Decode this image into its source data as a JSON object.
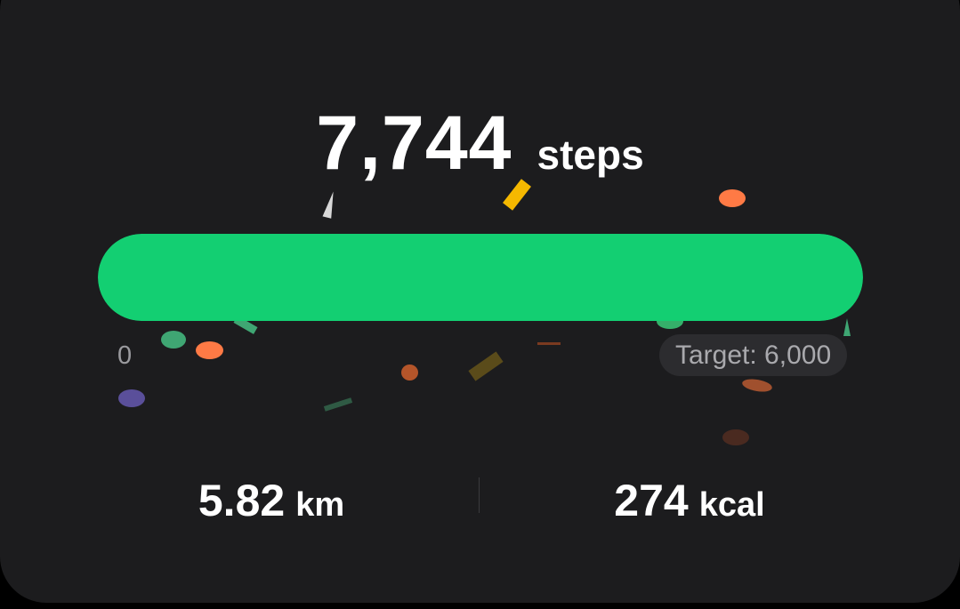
{
  "steps": {
    "value": "7,744",
    "unit": "steps"
  },
  "progress": {
    "current": 7744,
    "target": 6000,
    "fraction": 1.0,
    "min_label": "0",
    "target_label": "Target: 6,000",
    "color": "#13cf72"
  },
  "stats": {
    "distance": {
      "value": "5.82",
      "unit": "km"
    },
    "calories": {
      "value": "274",
      "unit": "kcal"
    }
  },
  "colors": {
    "card_background": "#1c1c1e",
    "page_background": "#000000",
    "accent_green": "#13cf72",
    "confetti": [
      "#f5b800",
      "#ff7a45",
      "#3fa673",
      "#5a4f9a",
      "#7a5a1a"
    ]
  }
}
